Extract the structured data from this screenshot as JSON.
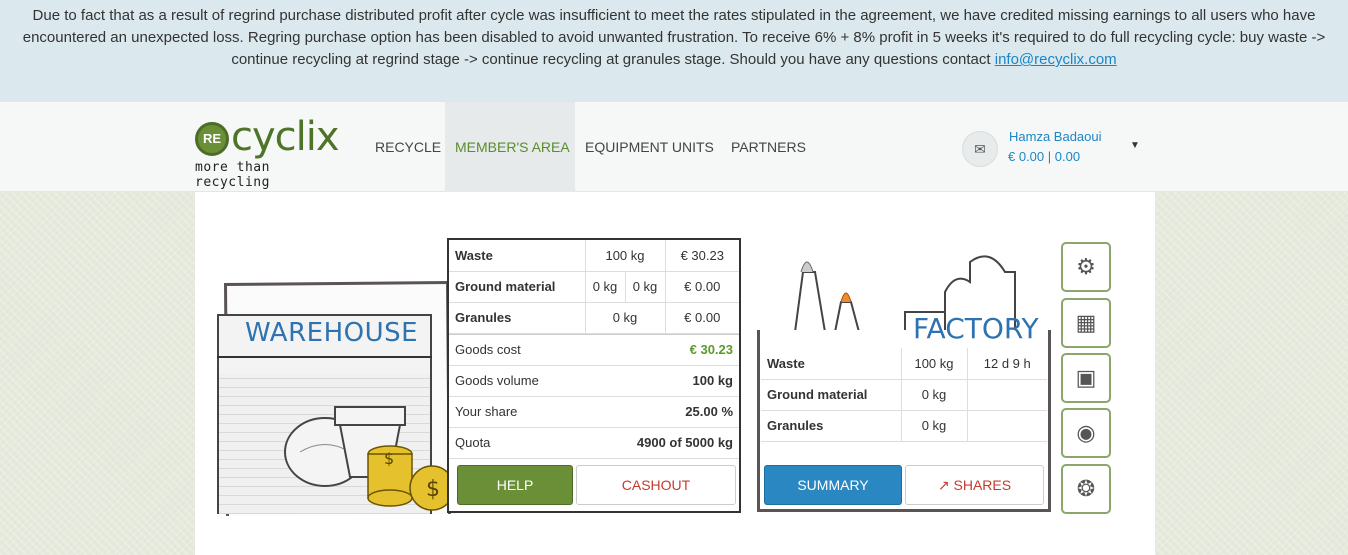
{
  "notice": {
    "text": "Due to fact that as a result of regrind purchase distributed profit after cycle was insufficient to meet the rates stipulated in the agreement, we have credited missing earnings to all users who have encountered an unexpected loss. Regring purchase option has been disabled to avoid unwanted frustration. To receive 6% + 8% profit in 5 weeks it's required to do full recycling cycle: buy waste -> continue recycling at regrind stage -> continue recycling at granules stage. Should you have any questions contact ",
    "email": "info@recyclix.com"
  },
  "logo": {
    "badge": "RE",
    "word": "cyclix",
    "tagline": "more than recycling"
  },
  "nav": [
    "RECYCLE",
    "MEMBER'S AREA",
    "EQUIPMENT UNITS",
    "PARTNERS"
  ],
  "user": {
    "name": "Hamza Badaoui",
    "balance": "€ 0.00 | 0.00",
    "icon": "envelope-icon"
  },
  "warehouse": {
    "title": "WAREHOUSE",
    "rows": [
      {
        "label": "Waste",
        "qty": "100 kg",
        "value": "€ 30.23"
      },
      {
        "label": "Ground material",
        "qty1": "0 kg",
        "qty2": "0 kg",
        "value": "€ 0.00"
      },
      {
        "label": "Granules",
        "qty": "0 kg",
        "value": "€ 0.00"
      }
    ],
    "stats": [
      {
        "label": "Goods cost",
        "value": "€ 30.23"
      },
      {
        "label": "Goods volume",
        "value": "100 kg"
      },
      {
        "label": "Your share",
        "value": "25.00 %"
      },
      {
        "label": "Quota",
        "value": "4900 of 5000 kg"
      }
    ],
    "help_label": "HELP",
    "cashout_label": "CASHOUT"
  },
  "factory": {
    "title": "FACTORY",
    "rows": [
      {
        "label": "Waste",
        "qty": "100 kg",
        "time": "12 d 9 h"
      },
      {
        "label": "Ground material",
        "qty": "0 kg",
        "time": ""
      },
      {
        "label": "Granules",
        "qty": "0 kg",
        "time": ""
      }
    ],
    "summary_label": "SUMMARY",
    "shares_label": "SHARES"
  },
  "side_icons": [
    "forklift-icon",
    "control-panel-icon",
    "shredder-icon",
    "extruder-icon",
    "granulator-icon"
  ],
  "colors": {
    "green": "#6a8f37",
    "blue": "#2b87c2",
    "red": "#c43b2e",
    "link": "#1b86c6"
  }
}
